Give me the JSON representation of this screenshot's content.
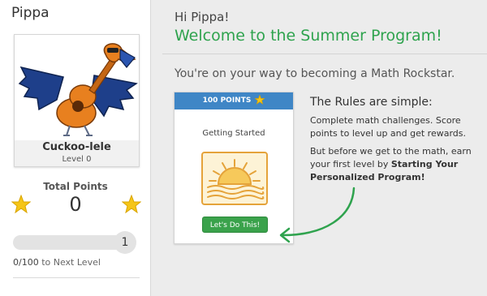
{
  "sidebar": {
    "user_name": "Pippa",
    "avatar": {
      "title": "Cuckoo-lele",
      "level": "Level 0"
    },
    "points": {
      "label": "Total Points",
      "value": "0"
    },
    "progress": {
      "fraction": 0,
      "level_badge": "1",
      "current": "0/100",
      "suffix": " to Next Level"
    }
  },
  "main": {
    "greeting": "Hi Pippa!",
    "welcome": "Welcome to the Summer Program!",
    "tagline": "You're on your way to becoming a Math Rockstar.",
    "task_card": {
      "points": "100 POINTS",
      "title": "Getting Started",
      "button": "Let's Do This!",
      "icon": "sunrise-icon"
    },
    "rules": {
      "title": "The Rules are simple:",
      "p1": "Complete math challenges. Score points to level up and get rewards.",
      "p2_prefix": "But before we get to the math, earn your first level by ",
      "p2_bold": "Starting Your Personalized Program!"
    }
  },
  "colors": {
    "accent_green": "#2fa34e",
    "header_blue": "#3f86c6",
    "star_gold": "#f5c518",
    "button_green": "#3aa24b"
  }
}
